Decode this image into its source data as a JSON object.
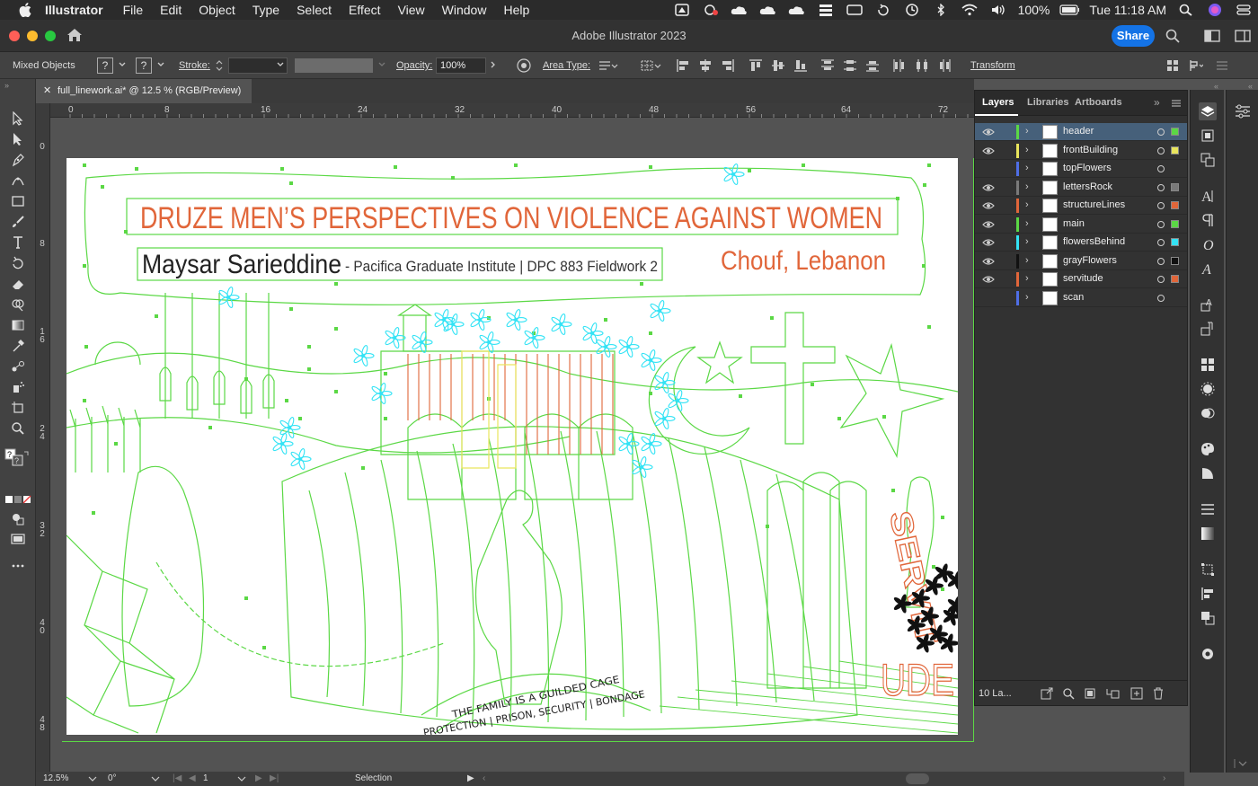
{
  "menubar": {
    "app": "Illustrator",
    "items": [
      "File",
      "Edit",
      "Object",
      "Type",
      "Select",
      "Effect",
      "View",
      "Window",
      "Help"
    ],
    "battery": "100%",
    "clock": "Tue 11:18 AM"
  },
  "window": {
    "title": "Adobe Illustrator 2023",
    "share": "Share"
  },
  "control": {
    "selection": "Mixed Objects",
    "q1": "?",
    "q2": "?",
    "stroke_label": "Stroke:",
    "opacity_label": "Opacity:",
    "opacity_value": "100%",
    "area_type_label": "Area Type:",
    "transform_label": "Transform"
  },
  "tab": {
    "name": "full_linework.ai* @ 12.5 % (RGB/Preview)"
  },
  "ruler": {
    "h": [
      "0",
      "8",
      "16",
      "24",
      "32",
      "40",
      "48",
      "56",
      "64",
      "72"
    ],
    "v": [
      "0",
      "8",
      "1\n6",
      "2\n4",
      "3\n2",
      "4\n0",
      "4\n8"
    ]
  },
  "artwork": {
    "title": "DRUZE MEN’S PERSPECTIVES ON VIOLENCE AGAINST WOMEN",
    "author": "Maysar Sarieddine",
    "subtitle": "- Pacifica Graduate Institute | DPC 883 Fieldwork 2",
    "location": "Chouf, Lebanon",
    "servitude_top": "SERVIT",
    "servitude_bottom": "UDE",
    "arc_line1": "THE FAMILY IS A GUILDED CAGE",
    "arc_line2": "PROTECTION | PRISON, SECURITY | BONDAGE",
    "colors": {
      "green": "#5bd845",
      "orange": "#e1663a",
      "cyan": "#33e3f5",
      "yellow": "#e9e55c"
    }
  },
  "layers": {
    "tabs": [
      "Layers",
      "Libraries",
      "Artboards"
    ],
    "rows": [
      {
        "name": "header",
        "color": "#5bd845",
        "eye": true,
        "selected": true,
        "sq": "#5bd845"
      },
      {
        "name": "frontBuilding",
        "color": "#e9e55c",
        "eye": true,
        "selected": false,
        "sq": "#e9e55c"
      },
      {
        "name": "topFlowers",
        "color": "#4f6ee6",
        "eye": false,
        "selected": false,
        "sq": ""
      },
      {
        "name": "lettersRock",
        "color": "#7a7a7a",
        "eye": true,
        "selected": false,
        "sq": "#7a7a7a"
      },
      {
        "name": "structureLines",
        "color": "#e1663a",
        "eye": true,
        "selected": false,
        "sq": "#e1663a"
      },
      {
        "name": "main",
        "color": "#5bd845",
        "eye": true,
        "selected": false,
        "sq": "#5bd845"
      },
      {
        "name": "flowersBehind",
        "color": "#33e3f5",
        "eye": true,
        "selected": false,
        "sq": "#33e3f5"
      },
      {
        "name": "grayFlowers",
        "color": "#111111",
        "eye": true,
        "selected": false,
        "sq": "#111111"
      },
      {
        "name": "servitude",
        "color": "#e1663a",
        "eye": true,
        "selected": false,
        "sq": "#e1663a"
      },
      {
        "name": "scan",
        "color": "#4f6ee6",
        "eye": false,
        "selected": false,
        "sq": ""
      }
    ],
    "count": "10 La..."
  },
  "status": {
    "zoom": "12.5%",
    "rotate": "0°",
    "artboard": "1",
    "tool": "Selection"
  }
}
